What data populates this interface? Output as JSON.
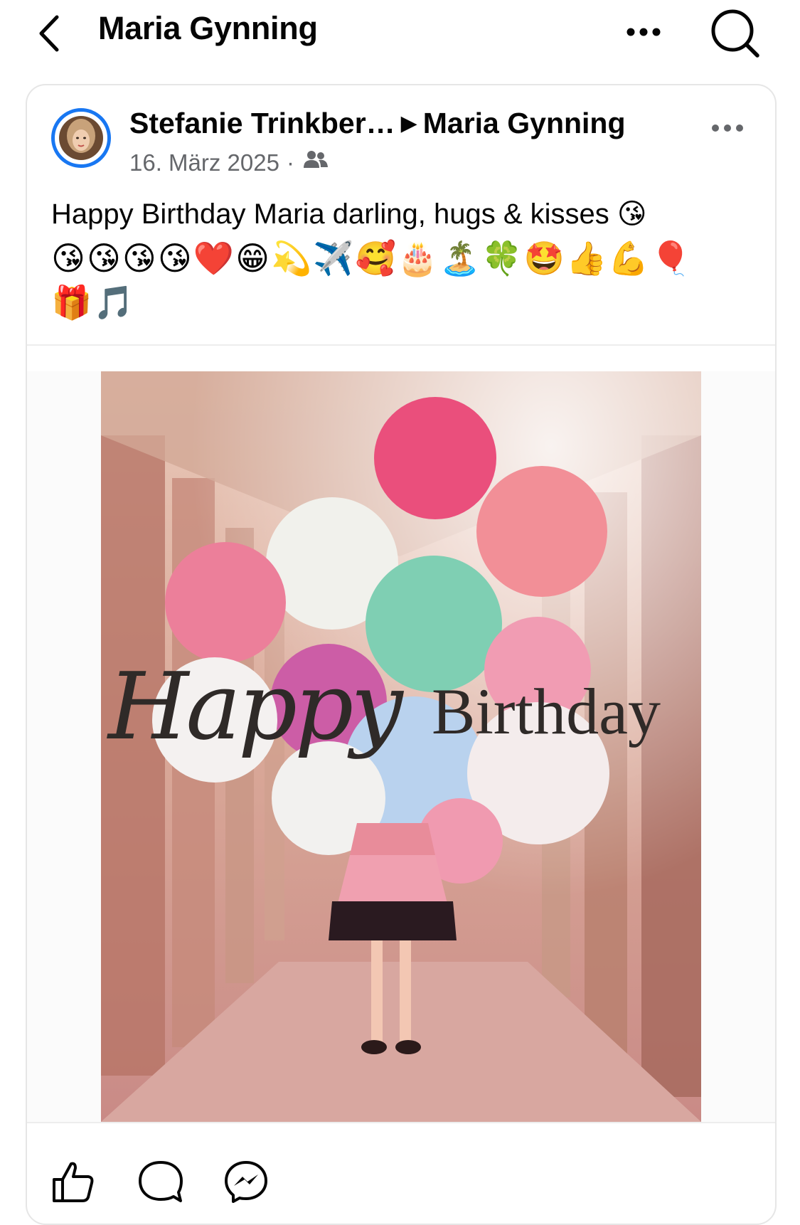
{
  "header": {
    "title": "Maria Gynning"
  },
  "post": {
    "author": "Stefanie Trinkber…",
    "arrow": "▶",
    "target": "Maria Gynning",
    "date": "16. März 2025",
    "separator": "·",
    "text": "Happy Birthday Maria darling, hugs & kisses 😘",
    "emoji_line_1": "😘😘😘😘❤️😁💫✈️🥰🎂🏝️🍀🤩👍💪🎈",
    "emoji_line_2": "🎁🎵",
    "image": {
      "title_word_1": "Happy",
      "title_word_2": "Birthday"
    }
  },
  "icons": {
    "back": "chevron-left-icon",
    "more": "more-dots-icon",
    "search": "search-icon",
    "audience": "friends-icon",
    "like": "thumbs-up-icon",
    "comment": "comment-icon",
    "share": "messenger-icon"
  },
  "colors": {
    "accent": "#1877f2",
    "text": "#050505",
    "secondary_text": "#65676b"
  }
}
